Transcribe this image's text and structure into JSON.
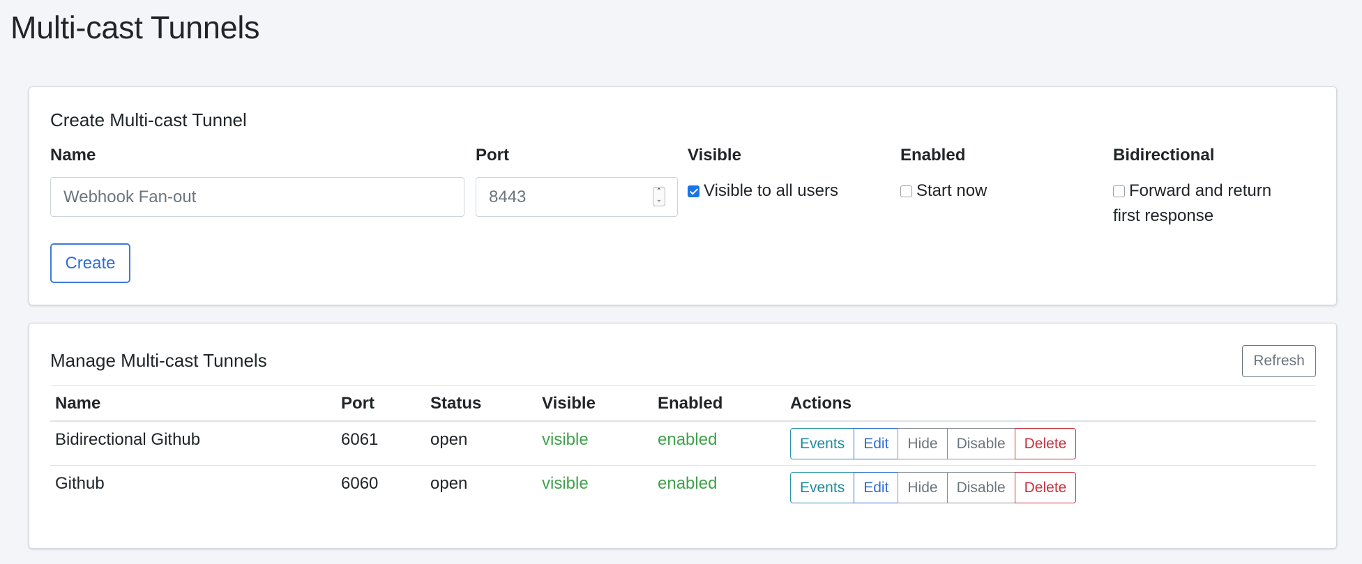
{
  "page": {
    "title": "Multi-cast Tunnels"
  },
  "create": {
    "title": "Create Multi-cast Tunnel",
    "name_label": "Name",
    "name_placeholder": "Webhook Fan-out",
    "port_label": "Port",
    "port_placeholder": "8443",
    "visible_label": "Visible",
    "visible_option": "Visible to all users",
    "visible_checked": true,
    "enabled_label": "Enabled",
    "enabled_option": "Start now",
    "enabled_checked": false,
    "bidirectional_label": "Bidirectional",
    "bidirectional_option": "Forward and return first response",
    "bidirectional_checked": false,
    "create_button": "Create"
  },
  "manage": {
    "title": "Manage Multi-cast Tunnels",
    "refresh_button": "Refresh",
    "columns": {
      "name": "Name",
      "port": "Port",
      "status": "Status",
      "visible": "Visible",
      "enabled": "Enabled",
      "actions": "Actions"
    },
    "actions": {
      "events": "Events",
      "edit": "Edit",
      "hide": "Hide",
      "disable": "Disable",
      "delete": "Delete"
    },
    "rows": [
      {
        "name": "Bidirectional Github",
        "port": "6061",
        "status": "open",
        "visible": "visible",
        "enabled": "enabled"
      },
      {
        "name": "Github",
        "port": "6060",
        "status": "open",
        "visible": "visible",
        "enabled": "enabled"
      }
    ]
  },
  "colors": {
    "accent": "#2f6fd3",
    "success": "#3fa24b",
    "info": "#1f8a9c",
    "danger": "#c8323f",
    "secondary": "#6c757d"
  }
}
